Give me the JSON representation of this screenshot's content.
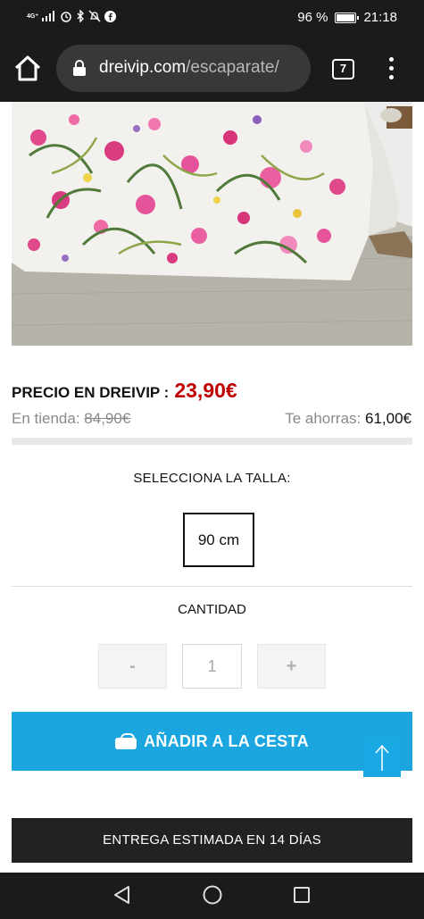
{
  "status_bar": {
    "network": "4G⁺",
    "battery": "96 %",
    "time": "21:18"
  },
  "browser": {
    "url_domain": "dreivip.com",
    "url_path": "/escaparate/",
    "tab_count": "7"
  },
  "product": {
    "price_label": "PRECIO EN DREIVIP :",
    "price": "23,90€",
    "store_label": "En tienda:",
    "store_price": "84,90€",
    "save_label": "Te ahorras:",
    "save_amount": "61,00€",
    "size_title": "SELECCIONA LA TALLA:",
    "size_option": "90 cm",
    "quantity_title": "CANTIDAD",
    "quantity_minus": "-",
    "quantity_value": "1",
    "quantity_plus": "+",
    "add_to_cart": "AÑADIR A LA CESTA",
    "delivery": "ENTREGA ESTIMADA EN 14 DÍAS"
  },
  "colors": {
    "price": "#c00000",
    "add_to_cart": "#1ba6e0",
    "delivery_bg": "#222222"
  },
  "icons": [
    "signal-icon",
    "alarm-icon",
    "bluetooth-icon",
    "mute-icon",
    "facebook-icon",
    "battery-icon",
    "home-icon",
    "lock-icon",
    "tabs-icon",
    "menu-icon",
    "bag-icon",
    "arrow-up-icon",
    "back-icon",
    "home-nav-icon",
    "recent-apps-icon"
  ]
}
